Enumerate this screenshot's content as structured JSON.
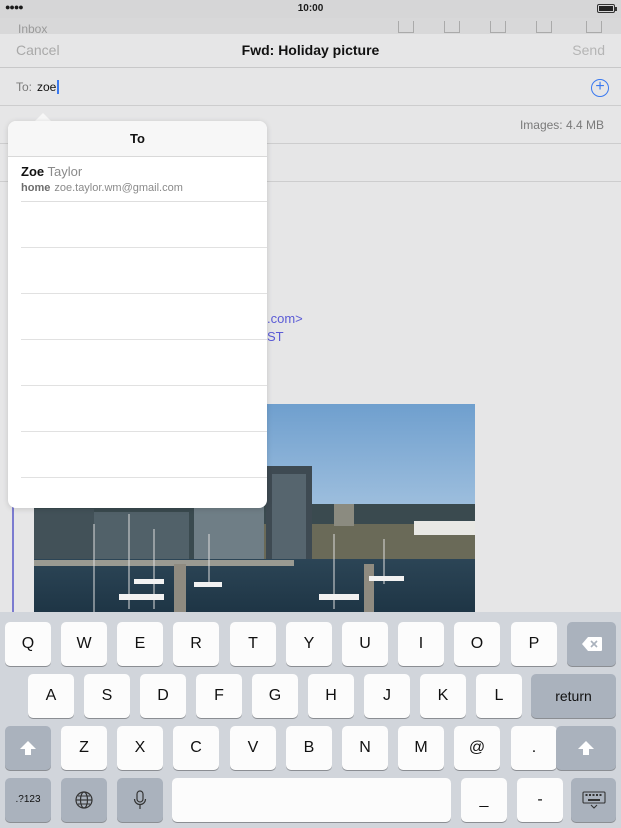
{
  "status": {
    "signal": "●●●●",
    "time": "10:00"
  },
  "background_toolbar": {
    "back_label": "Inbox"
  },
  "compose": {
    "cancel": "Cancel",
    "title": "Fwd: Holiday picture",
    "send": "Send",
    "to_label": "To:",
    "to_value": "zoe",
    "images_size": "Images: 4.4 MB",
    "body_link_1": ".com>",
    "body_link_2": "ST"
  },
  "autocomplete": {
    "header": "To",
    "suggestions": [
      {
        "first_name": "Zoe",
        "last_name": "Taylor",
        "type": "home",
        "email": "zoe.taylor.wm@gmail.com"
      }
    ]
  },
  "keyboard": {
    "row1": [
      "Q",
      "W",
      "E",
      "R",
      "T",
      "Y",
      "U",
      "I",
      "O",
      "P"
    ],
    "row2": [
      "A",
      "S",
      "D",
      "F",
      "G",
      "H",
      "J",
      "K",
      "L"
    ],
    "return": "return",
    "row3": [
      "Z",
      "X",
      "C",
      "V",
      "B",
      "N",
      "M",
      "@",
      "."
    ],
    "numbers": ".?123",
    "underscore": "_",
    "dash": "-"
  },
  "colors": {
    "accent": "#3a79f0",
    "link": "#5b5bd6",
    "keyboard_bg": "#d1d5db",
    "dark_key": "#aab2bd"
  }
}
